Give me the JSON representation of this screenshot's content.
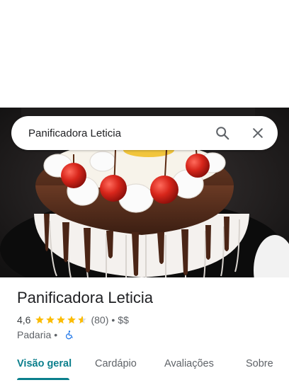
{
  "search": {
    "query": "Panificadora Leticia"
  },
  "place": {
    "name": "Panificadora Leticia",
    "rating": "4,6",
    "stars": 4.6,
    "reviews": "(80)",
    "price": "$$",
    "category": "Padaria",
    "separator": "•"
  },
  "icons": {
    "search": "search-icon",
    "close": "close-icon",
    "star": "star-icon",
    "accessible": "wheelchair-icon"
  },
  "colors": {
    "accent": "#0b7f8c",
    "star": "#fbbc04",
    "accessible": "#1a73e8"
  },
  "tabs": [
    {
      "label": "Visão geral",
      "active": true
    },
    {
      "label": "Cardápio",
      "active": false
    },
    {
      "label": "Avaliações",
      "active": false
    },
    {
      "label": "Sobre",
      "active": false
    }
  ]
}
